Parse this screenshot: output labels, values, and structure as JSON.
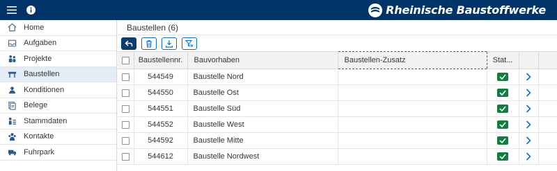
{
  "brand": {
    "name": "Rheinische Baustoffwerke"
  },
  "sidebar": {
    "items": [
      {
        "label": "Home",
        "icon": "home-icon",
        "active": false
      },
      {
        "label": "Aufgaben",
        "icon": "inbox-icon",
        "active": false
      },
      {
        "label": "Projekte",
        "icon": "people-icon",
        "active": false
      },
      {
        "label": "Baustellen",
        "icon": "construction-icon",
        "active": true
      },
      {
        "label": "Konditionen",
        "icon": "conditions-icon",
        "active": false
      },
      {
        "label": "Belege",
        "icon": "documents-icon",
        "active": false
      },
      {
        "label": "Stammdaten",
        "icon": "master-data-icon",
        "active": false
      },
      {
        "label": "Kontakte",
        "icon": "contacts-icon",
        "active": false
      },
      {
        "label": "Fuhrpark",
        "icon": "truck-icon",
        "active": false
      }
    ]
  },
  "page": {
    "title": "Baustellen (6)"
  },
  "table": {
    "headers": {
      "nr": "Baustellennr.",
      "vorhaben": "Bauvorhaben",
      "zusatz": "Baustellen-Zusatz",
      "status": "Stat..."
    },
    "rows": [
      {
        "nr": "544549",
        "vorhaben": "Baustelle Nord",
        "zusatz": ""
      },
      {
        "nr": "544550",
        "vorhaben": "Baustelle Ost",
        "zusatz": ""
      },
      {
        "nr": "544551",
        "vorhaben": "Baustelle Süd",
        "zusatz": ""
      },
      {
        "nr": "544552",
        "vorhaben": "Baustelle West",
        "zusatz": ""
      },
      {
        "nr": "544592",
        "vorhaben": "Baustelle Mitte",
        "zusatz": ""
      },
      {
        "nr": "544612",
        "vorhaben": "Baustelle Nordwest",
        "zusatz": ""
      }
    ]
  },
  "colors": {
    "shell": "#003368",
    "accent": "#0a6ed1",
    "status_ok": "#107e3e",
    "active_nav": "#e4edf7"
  }
}
